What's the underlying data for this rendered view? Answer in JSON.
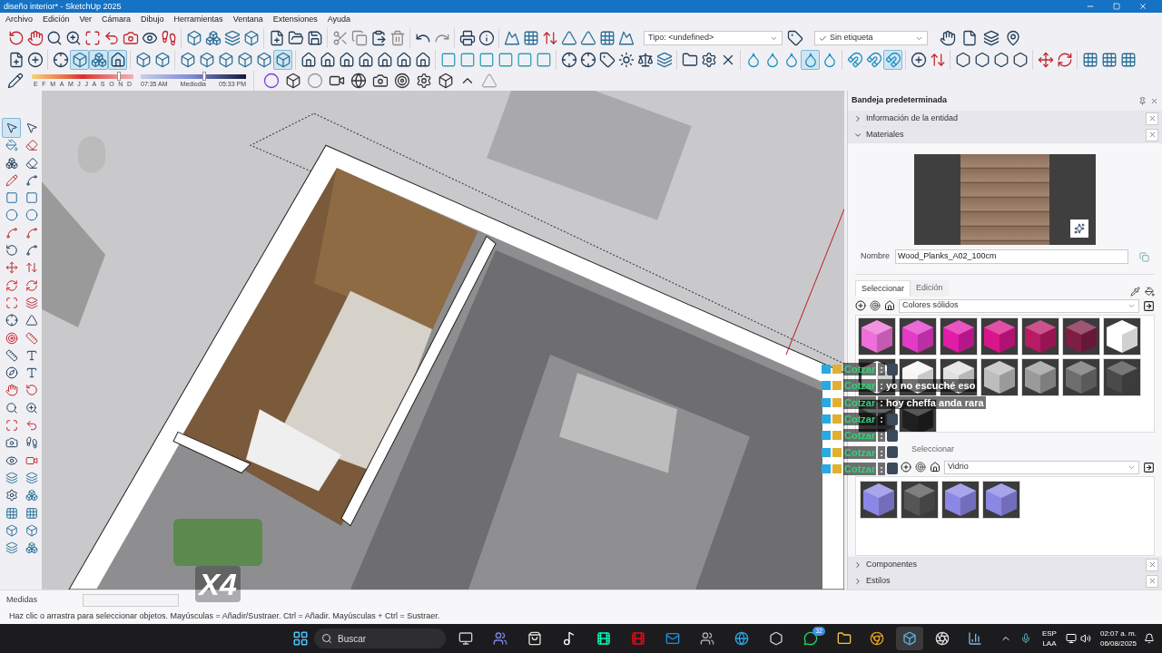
{
  "window": {
    "title": "diseño interior* - SketchUp 2025"
  },
  "menu": [
    "Archivo",
    "Edición",
    "Ver",
    "Cámara",
    "Dibujo",
    "Herramientas",
    "Ventana",
    "Extensiones",
    "Ayuda"
  ],
  "toolbars": [
    {
      "groups": [
        {
          "buttons": [
            {
              "selected": false
            },
            {
              "selected": false
            },
            {
              "selected": false
            },
            {
              "selected": false
            },
            {
              "selected": false
            },
            {
              "selected": false
            },
            {
              "selected": false
            },
            {
              "selected": false
            },
            {
              "selected": false
            }
          ]
        },
        {
          "buttons": [
            {
              "selected": false
            },
            {
              "selected": false
            },
            {
              "selected": false
            },
            {
              "selected": false
            }
          ]
        },
        {
          "buttons": [
            {
              "selected": false
            },
            {
              "selected": false
            },
            {
              "selected": false
            }
          ]
        },
        {
          "buttons": [
            {
              "selected": false
            },
            {
              "selected": false
            },
            {
              "selected": false
            },
            {
              "selected": false
            }
          ]
        },
        {
          "buttons": [
            {
              "selected": false
            },
            {
              "selected": false
            }
          ]
        },
        {
          "buttons": [
            {
              "selected": false
            },
            {
              "selected": false
            }
          ]
        },
        {
          "buttons": [
            {
              "selected": false
            },
            {
              "selected": false
            },
            {
              "selected": false
            },
            {
              "selected": false
            },
            {
              "selected": false
            },
            {
              "selected": false
            },
            {
              "selected": false
            }
          ]
        }
      ]
    },
    {
      "groups": [
        {
          "buttons": [
            {
              "selected": false
            },
            {
              "selected": false
            }
          ]
        },
        {
          "buttons": [
            {
              "selected": false
            },
            {
              "selected": true
            },
            {
              "selected": true
            },
            {
              "selected": true
            }
          ]
        },
        {
          "buttons": [
            {
              "selected": false
            },
            {
              "selected": false
            }
          ]
        },
        {
          "buttons": [
            {
              "selected": false
            },
            {
              "selected": false
            },
            {
              "selected": false
            },
            {
              "selected": false
            },
            {
              "selected": false
            },
            {
              "selected": true
            }
          ]
        },
        {
          "buttons": [
            {
              "selected": false
            },
            {
              "selected": false
            },
            {
              "selected": false
            },
            {
              "selected": false
            },
            {
              "selected": false
            },
            {
              "selected": false
            },
            {
              "selected": false
            }
          ]
        },
        {
          "buttons": [
            {
              "selected": false
            },
            {
              "selected": false
            },
            {
              "selected": false
            },
            {
              "selected": false
            },
            {
              "selected": false
            },
            {
              "selected": false
            }
          ]
        },
        {
          "buttons": [
            {
              "selected": false
            },
            {
              "selected": false
            },
            {
              "selected": false
            },
            {
              "selected": false
            },
            {
              "selected": false
            },
            {
              "selected": false
            }
          ]
        },
        {
          "buttons": [
            {
              "selected": false
            },
            {
              "selected": false
            },
            {
              "selected": false
            }
          ]
        },
        {
          "buttons": [
            {
              "selected": false
            },
            {
              "selected": false
            },
            {
              "selected": false
            },
            {
              "selected": true
            },
            {
              "selected": false
            }
          ]
        },
        {
          "buttons": [
            {
              "selected": false
            },
            {
              "selected": false
            },
            {
              "selected": true
            }
          ]
        },
        {
          "buttons": [
            {
              "selected": false
            },
            {
              "selected": false
            }
          ]
        },
        {
          "buttons": [
            {
              "selected": false
            },
            {
              "selected": false
            },
            {
              "selected": false
            },
            {
              "selected": false
            }
          ]
        },
        {
          "buttons": [
            {
              "selected": false
            },
            {
              "selected": false
            }
          ]
        },
        {
          "buttons": [
            {
              "selected": false
            },
            {
              "selected": false
            },
            {
              "selected": false
            }
          ]
        }
      ]
    }
  ],
  "type_dropdown": {
    "value": "Tipo: <undefined>"
  },
  "tag_dropdown": {
    "value": "Sin etiqueta"
  },
  "shadows": {
    "months": [
      "E",
      "F",
      "M",
      "A",
      "M",
      "J",
      "J",
      "A",
      "S",
      "O",
      "N",
      "D"
    ],
    "date_slider": {
      "level": 0.86
    },
    "time_slider": {
      "level": 0.6
    },
    "time_labels": [
      "07:35 AM",
      "Mediodia",
      "05:33 PM"
    ]
  },
  "tool_palette": {
    "buttons": [
      {
        "selected": true
      },
      {
        "selected": false
      },
      {
        "selected": false
      },
      {
        "selected": false
      },
      {
        "selected": false
      },
      {
        "selected": false
      },
      {
        "selected": false
      },
      {
        "selected": false
      },
      {
        "selected": false
      },
      {
        "selected": false
      },
      {
        "selected": false
      },
      {
        "selected": false
      },
      {
        "selected": false
      },
      {
        "selected": false
      },
      {
        "selected": false
      },
      {
        "selected": false
      },
      {
        "selected": false
      },
      {
        "selected": false
      },
      {
        "selected": false
      },
      {
        "selected": false
      },
      {
        "selected": false
      },
      {
        "selected": false
      },
      {
        "selected": false
      },
      {
        "selected": false
      },
      {
        "selected": false
      },
      {
        "selected": false
      },
      {
        "selected": false
      },
      {
        "selected": false
      },
      {
        "selected": false
      },
      {
        "selected": false
      },
      {
        "selected": false
      },
      {
        "selected": false
      },
      {
        "selected": false
      },
      {
        "selected": false
      },
      {
        "selected": false
      },
      {
        "selected": false
      },
      {
        "selected": false
      },
      {
        "selected": false
      },
      {
        "selected": false
      },
      {
        "selected": false
      },
      {
        "selected": false
      },
      {
        "selected": false
      },
      {
        "selected": false
      },
      {
        "selected": false
      },
      {
        "selected": false
      },
      {
        "selected": false
      },
      {
        "selected": false
      },
      {
        "selected": false
      },
      {
        "selected": false
      },
      {
        "selected": false
      }
    ]
  },
  "tray": {
    "title": "Bandeja predeterminada",
    "panels_top": [
      {
        "title": "Información de la entidad",
        "expanded": false
      },
      {
        "title": "Materiales",
        "expanded": true
      }
    ],
    "materials": {
      "name_label": "Nombre",
      "name_value": "Wood_Planks_A02_100cm",
      "tabs": [
        {
          "label": "Seleccionar",
          "selected": true
        },
        {
          "label": "Edición",
          "selected": false
        }
      ],
      "library": "Colores sólidos",
      "swatches": [
        {
          "color": "#ee6fd9"
        },
        {
          "color": "#e43ac8"
        },
        {
          "color": "#e01ca9"
        },
        {
          "color": "#d8158a"
        },
        {
          "color": "#b81a64"
        },
        {
          "color": "#7e1e45"
        },
        {
          "color": "#ffffff"
        },
        {
          "color": "#ffffff"
        },
        {
          "color": "#f6f6f6"
        },
        {
          "color": "#e0e0e0"
        },
        {
          "color": "#bdbdbd"
        },
        {
          "color": "#9a9a9a"
        },
        {
          "color": "#6e6e6e"
        },
        {
          "color": "#4a4a4a"
        },
        {
          "color": "#333333"
        },
        {
          "color": "#1f1f1f"
        }
      ],
      "second_tab": "Seleccionar",
      "second_library": "Vidrio",
      "second_swatches": [
        {
          "color": "#8b87e4"
        },
        {
          "color": "#555555"
        },
        {
          "color": "#8b87e4"
        },
        {
          "color": "#8b87e4"
        }
      ]
    },
    "panels_bottom": [
      {
        "title": "Componentes",
        "expanded": false
      },
      {
        "title": "Estilos",
        "expanded": false
      }
    ]
  },
  "chat": [
    {
      "user": "Cotzar",
      "kind": "emote",
      "text": ":"
    },
    {
      "user": "Cotzar",
      "kind": "text",
      "text": ": yo no escuché eso"
    },
    {
      "user": "Cotzar",
      "kind": "text",
      "text": ": hoy cheffa anda rara"
    },
    {
      "user": "Cotzar",
      "kind": "emote",
      "text": ":"
    },
    {
      "user": "Cotzar",
      "kind": "emote",
      "text": ":"
    },
    {
      "user": "Cotzar",
      "kind": "emote",
      "text": ":"
    },
    {
      "user": "Cotzar",
      "kind": "emote",
      "text": ":"
    }
  ],
  "overlay_emote": {
    "text": "X4"
  },
  "measurements": {
    "label": "Medidas"
  },
  "status_bar": "Haz clic o arrastra para seleccionar objetos. Mayúsculas = Añadir/Sustraer. Ctrl = Añadir. Mayúsculas + Ctrl = Sustraer.",
  "taskbar": {
    "search_placeholder": "Buscar",
    "whatsapp_badge": "32",
    "language": [
      "ESP",
      "LAA"
    ],
    "time": "02:07 a. m.",
    "date": "06/08/2025"
  }
}
